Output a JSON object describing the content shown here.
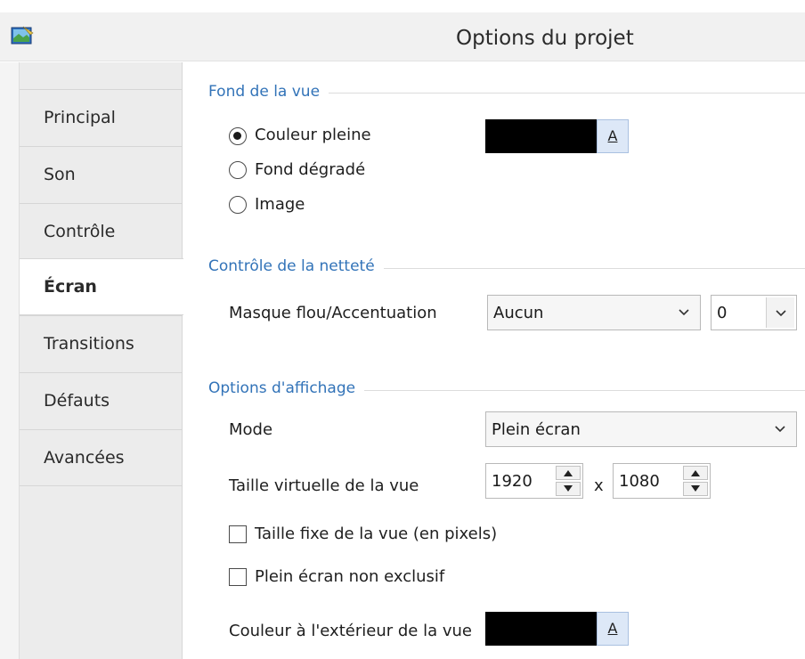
{
  "window": {
    "title": "Options du projet",
    "icon": "app-icon"
  },
  "sidebar": {
    "tabs": [
      {
        "label": "Principal",
        "active": false
      },
      {
        "label": "Son",
        "active": false
      },
      {
        "label": "Contrôle",
        "active": false
      },
      {
        "label": "Écran",
        "active": true
      },
      {
        "label": "Transitions",
        "active": false
      },
      {
        "label": "Défauts",
        "active": false
      },
      {
        "label": "Avancées",
        "active": false
      }
    ]
  },
  "background": {
    "section_title": "Fond de la vue",
    "options": [
      {
        "label": "Couleur pleine",
        "checked": true
      },
      {
        "label": "Fond dégradé",
        "checked": false
      },
      {
        "label": "Image",
        "checked": false
      }
    ],
    "color": "#000000",
    "color_button_label": "A"
  },
  "sharpness": {
    "section_title": "Contrôle de la netteté",
    "label": "Masque flou/Accentuation",
    "mode_value": "Aucun",
    "amount_value": "0"
  },
  "display": {
    "section_title": "Options d'affichage",
    "mode_label": "Mode",
    "mode_value": "Plein écran",
    "virtual_size_label": "Taille virtuelle de la vue",
    "width_value": "1920",
    "separator": "x",
    "height_value": "1080",
    "fixed_size_label": "Taille fixe de la vue (en pixels)",
    "fixed_size_checked": false,
    "non_exclusive_label": "Plein écran non exclusif",
    "non_exclusive_checked": false,
    "outside_color_label": "Couleur à l'extérieur de la vue",
    "outside_color": "#000000",
    "outside_color_button_label": "A"
  },
  "colors": {
    "accent": "#3273b8",
    "sidebar_bg": "#ececec",
    "button_bg": "#dde8f7"
  }
}
